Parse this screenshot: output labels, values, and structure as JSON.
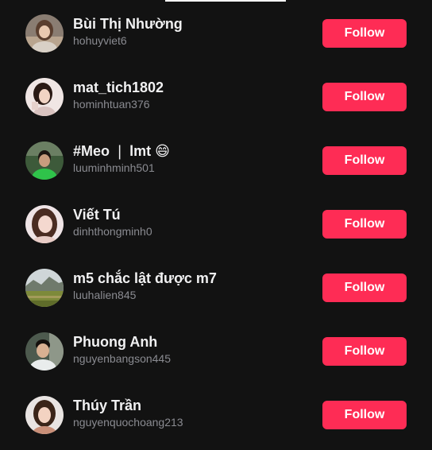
{
  "colors": {
    "background": "#121212",
    "name_text": "#f1f1f2",
    "username_text": "#8a8b91",
    "follow_button": "#fe2c55"
  },
  "suggested_accounts": [
    {
      "display_name": "Bùi Thị Nhường",
      "username": "hohuyviet6",
      "button_label": "Follow",
      "avatar_icon": "avatar-photo"
    },
    {
      "display_name": "mat_tich1802",
      "username": "hominhtuan376",
      "button_label": "Follow",
      "avatar_icon": "avatar-photo"
    },
    {
      "display_name": "#Meo ❘ lmt 😄",
      "username": "luuminhminh501",
      "button_label": "Follow",
      "avatar_icon": "avatar-photo"
    },
    {
      "display_name": "Viết Tú",
      "username": "dinhthongminh0",
      "button_label": "Follow",
      "avatar_icon": "avatar-photo"
    },
    {
      "display_name": "m5 chắc lật được m7",
      "username": "luuhalien845",
      "button_label": "Follow",
      "avatar_icon": "avatar-landscape-photo"
    },
    {
      "display_name": "Phuong Anh",
      "username": "nguyenbangson445",
      "button_label": "Follow",
      "avatar_icon": "avatar-photo"
    },
    {
      "display_name": "Thúy Trần",
      "username": "nguyenquochoang213",
      "button_label": "Follow",
      "avatar_icon": "avatar-photo"
    }
  ]
}
